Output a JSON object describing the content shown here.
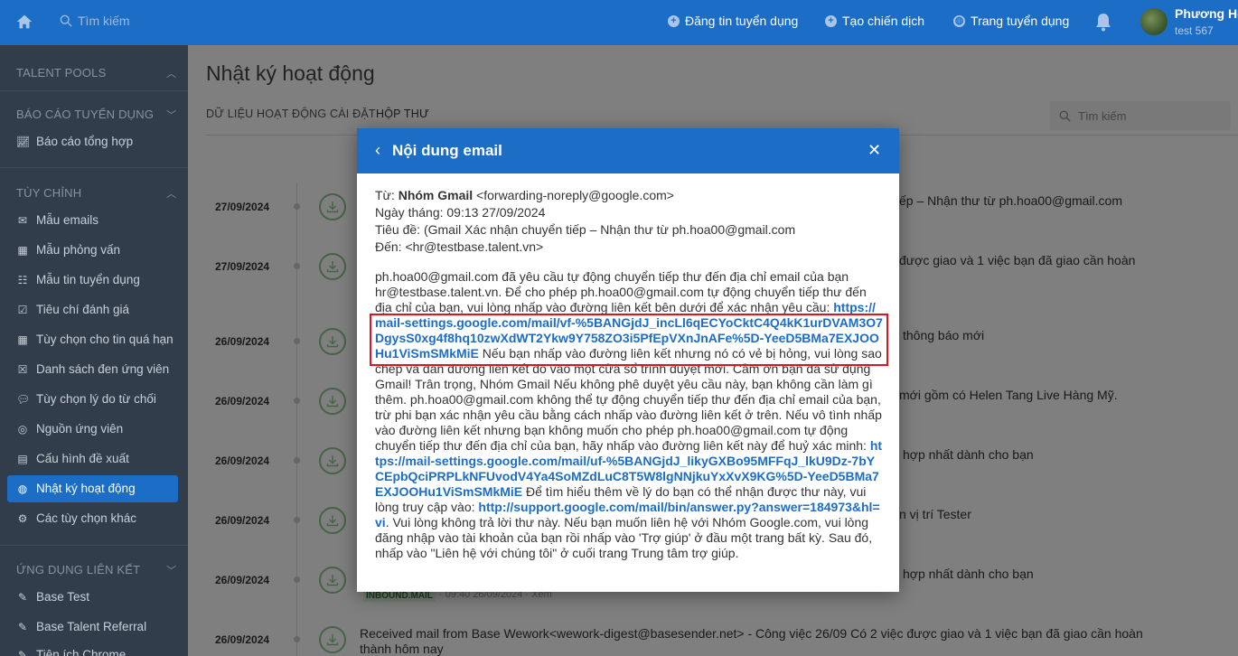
{
  "topbar": {
    "search_placeholder": "Tìm kiếm",
    "links": [
      "Đăng tin tuyển dụng",
      "Tạo chiến dịch",
      "Trang tuyển dụng"
    ],
    "user_name": "Phương Ho",
    "user_sub": "test 567"
  },
  "sidebar": {
    "sections": [
      {
        "title": "TALENT POOLS"
      },
      {
        "title": "BÁO CÁO TUYỂN DỤNG",
        "items": [
          "Báo cáo tổng hợp"
        ]
      },
      {
        "title": "TÙY CHỈNH",
        "items": [
          "Mẫu emails",
          "Mẫu phỏng vấn",
          "Mẫu tin tuyển dụng",
          "Tiêu chí đánh giá",
          "Tùy chọn cho tin quá hạn",
          "Danh sách đen ứng viên",
          "Tùy chọn lý do từ chối",
          "Nguồn ứng viên",
          "Cấu hình đề xuất",
          "Nhật ký hoạt động",
          "Các tùy chọn khác"
        ]
      },
      {
        "title": "ỨNG DỤNG LIÊN KẾT",
        "items": [
          "Base Test",
          "Base Talent Referral",
          "Tiện ích Chrome"
        ]
      }
    ]
  },
  "main": {
    "title": "Nhật ký hoạt động",
    "tabs": [
      "DỮ LIỆU HOẠT ĐỘNG CÀI ĐẶT",
      "HỘP THƯ"
    ],
    "search_placeholder": "Tìm kiếm",
    "rows": [
      {
        "date": "27/09/2024",
        "text": "ếp – Nhận thư từ ph.hoa00@gmail.com"
      },
      {
        "date": "27/09/2024",
        "text": "được giao và 1 việc bạn đã giao cần hoàn"
      },
      {
        "date": "26/09/2024",
        "text": "thông báo mới"
      },
      {
        "date": "26/09/2024",
        "text": "mới gồm có Helen Tang Live Hàng Mỹ."
      },
      {
        "date": "26/09/2024",
        "text": "hợp nhất dành cho bạn"
      },
      {
        "date": "26/09/2024",
        "text": "n vị trí Tester"
      },
      {
        "date": "26/09/2024",
        "text": "hợp nhất dành cho bạn"
      },
      {
        "date": "26/09/2024",
        "text": "Received mail from Base Wework<wework-digest@basesender.net> - Công việc 26/09 Có 2 việc được giao và 1 việc bạn đã giao cần hoàn",
        "text2": "thành hôm nay"
      }
    ],
    "badge": "INBOUND.MAIL",
    "meta": "· 09:40 26/09/2024 · Xem"
  },
  "modal": {
    "title": "Nội dung email",
    "from_label": "Từ: ",
    "from_name": "Nhóm Gmail",
    "from_email": " <forwarding-noreply@google.com>",
    "date_line": "Ngày tháng: 09:13 27/09/2024",
    "subject_line": "Tiêu đề: (Gmail Xác nhận chuyển tiếp – Nhận thư từ ph.hoa00@gmail.com",
    "to_line": "Đến: <hr@testbase.talent.vn>",
    "p1": "ph.hoa00@gmail.com đã yêu cầu tự động chuyển tiếp thư đến địa chỉ email của bạn hr@testbase.talent.vn. Để cho phép ph.hoa00@gmail.com tự động chuyển tiếp thư đến địa chỉ của bạn, vui lòng nhấp vào đường liên kết bên dưới để xác nhận yêu cầu:",
    "link1": "https://mail-settings.google.com/mail/vf-%5BANGjdJ_incLl6qECYoCktC4Q4kK1urDVAM3O7DgysS0xg4f8hq10zwXdWT2Ykw9Y758ZO3i5PfEpVXnJnAFe%5D-YeeD5BMa7EXJOOHu1ViSmSMkMiE",
    "p2": " Nếu bạn nhấp vào đường liên kết nhưng nó có vẻ bị hỏng, vui lòng sao chép và dán đường liên kết đó vào một cửa sổ trình duyệt mới. Cảm ơn bạn đã sử dụng Gmail! Trân trọng, Nhóm Gmail Nếu không phê duyệt yêu cầu này, bạn không cần làm gì thêm. ph.hoa00@gmail.com không thể tự động chuyển tiếp thư đến địa chỉ email của bạn, trừ phi bạn xác nhận yêu cầu bằng cách nhấp vào đường liên kết ở trên. Nếu vô tình nhấp vào đường liên kết nhưng bạn không muốn cho phép ph.hoa00@gmail.com tự động chuyển tiếp thư đến địa chỉ của bạn, hãy nhấp vào đường liên kết này để huỷ xác minh: ",
    "link2": "https://mail-settings.google.com/mail/uf-%5BANGjdJ_likyGXBo95MFFqJ_lkU9Dz-7bYCEpbQciPRPLkNFUvodV4Ya4SoMZdLuC8T5W8lgNNjkuYxXvX9KG%5D-YeeD5BMa7EXJOOHu1ViSmSMkMiE",
    "p3": " Để tìm hiểu thêm về lý do bạn có thể nhận được thư này, vui lòng truy cập vào: ",
    "link3": "http://support.google.com/mail/bin/answer.py?answer=184973&hl=vi",
    "p4": ". Vui lòng không trả lời thư này. Nếu bạn muốn liên hệ với Nhóm Google.com, vui lòng đăng nhập vào tài khoản của bạn rồi nhấp vào 'Trợ giúp' ở đầu một trang bất kỳ. Sau đó, nhấp vào \"Liên hệ với chúng tôi\" ở cuối trang Trung tâm trợ giúp."
  }
}
